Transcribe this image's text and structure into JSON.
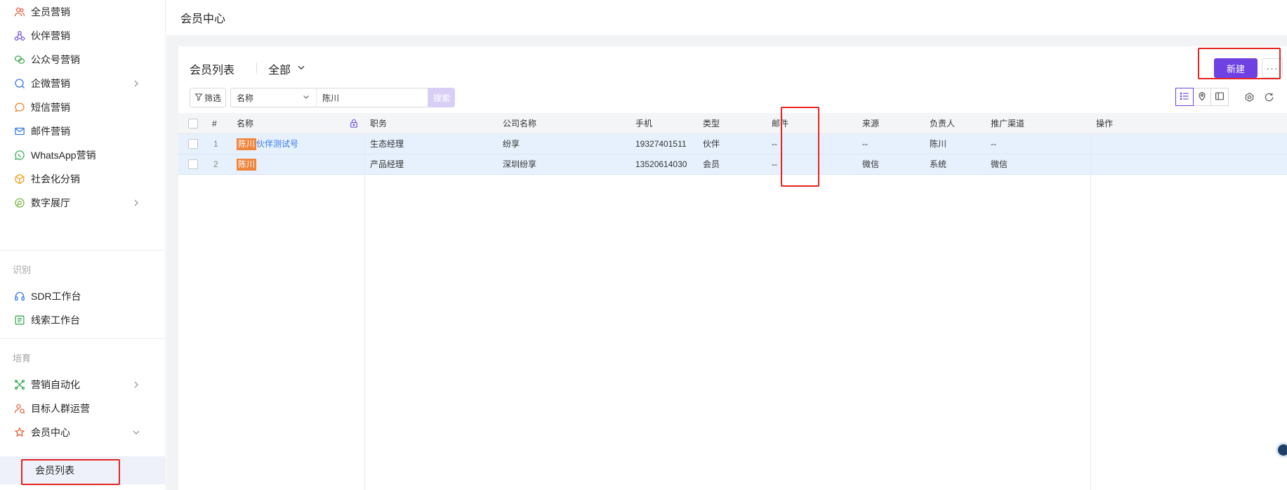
{
  "sidebar": {
    "items": [
      {
        "label": "全员营销",
        "icon": "user-group-icon"
      },
      {
        "label": "伙伴营销",
        "icon": "partner-network-icon"
      },
      {
        "label": "公众号营销",
        "icon": "wechat-icon"
      },
      {
        "label": "企微营销",
        "icon": "wecom-chat-icon"
      },
      {
        "label": "短信营销",
        "icon": "sms-bubble-icon"
      },
      {
        "label": "邮件营销",
        "icon": "mail-icon"
      },
      {
        "label": "WhatsApp营销",
        "icon": "whatsapp-icon"
      },
      {
        "label": "社会化分销",
        "icon": "distribution-icon"
      },
      {
        "label": "数字展厅",
        "icon": "showroom-icon"
      }
    ],
    "section_identify": "识别",
    "identify_items": [
      {
        "label": "SDR工作台",
        "icon": "headset-icon"
      },
      {
        "label": "线索工作台",
        "icon": "clue-board-icon"
      }
    ],
    "section_nurture": "培育",
    "nurture_items": [
      {
        "label": "营销自动化",
        "icon": "automation-icon"
      },
      {
        "label": "目标人群运营",
        "icon": "target-audience-icon"
      },
      {
        "label": "会员中心",
        "icon": "member-star-icon"
      }
    ],
    "sub_item": "会员列表"
  },
  "header": {
    "title": "会员中心"
  },
  "list": {
    "title": "会员列表",
    "view": "全部",
    "new_label": "新建",
    "more_label": "···",
    "filter_label": "筛选",
    "search_field": "名称",
    "search_value": "陈川",
    "search_button": "搜索"
  },
  "table": {
    "columns": [
      "#",
      "名称",
      "职务",
      "公司名称",
      "手机",
      "类型",
      "邮件",
      "来源",
      "负责人",
      "推广渠道",
      "操作"
    ],
    "rows": [
      {
        "index": "1",
        "name_tag": "陈川",
        "name_rest": "伙伴测试号",
        "title": "生态经理",
        "company": "纷享",
        "phone": "19327401511",
        "type": "伙伴",
        "email": "--",
        "source": "--",
        "owner": "陈川",
        "channel": "--"
      },
      {
        "index": "2",
        "name_tag": "陈川",
        "name_rest": "",
        "title": "产品经理",
        "company": "深圳纷享",
        "phone": "13520614030",
        "type": "会员",
        "email": "--",
        "source": "微信",
        "owner": "系统",
        "channel": "微信"
      }
    ]
  },
  "colors": {
    "accent": "#6e41e2",
    "highlight": "#e52422",
    "row_selected": "#e6f1fd",
    "name_tag": "#f0843a"
  }
}
